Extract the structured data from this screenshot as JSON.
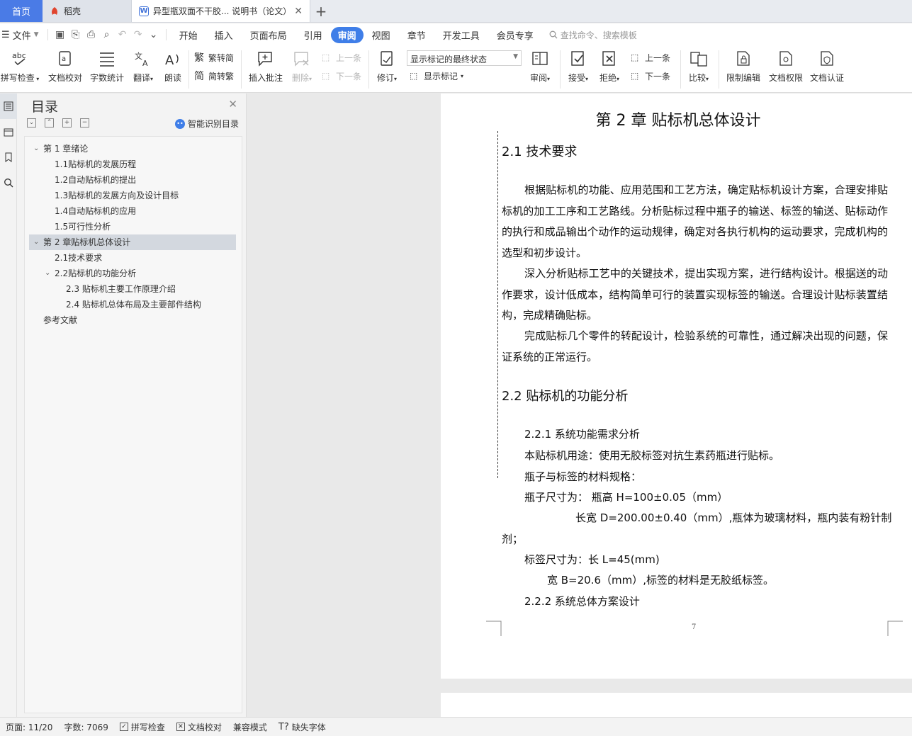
{
  "tabs": {
    "home": "首页",
    "daoke": "稻壳",
    "document": "异型瓶双面不干胶... 说明书（论文）"
  },
  "menubar": {
    "file": "文件",
    "items": [
      "开始",
      "插入",
      "页面布局",
      "引用",
      "审阅",
      "视图",
      "章节",
      "开发工具",
      "会员专享"
    ],
    "active_item": "审阅",
    "search_placeholder": "查找命令、搜索模板"
  },
  "ribbon": {
    "spellcheck": "拼写检查",
    "doc_proof": "文档校对",
    "word_count": "字数统计",
    "translate": "翻译",
    "read_aloud": "朗读",
    "to_traditional": "繁转简",
    "to_simplified": "简转繁",
    "insert_comment": "插入批注",
    "delete": "删除",
    "prev": "上一条",
    "next": "下一条",
    "track_changes": "修订",
    "markup_state": "显示标记的最终状态",
    "show_markup": "显示标记",
    "review": "审阅",
    "accept": "接受",
    "reject": "拒绝",
    "prev2": "上一条",
    "next2": "下一条",
    "compare": "比较",
    "restrict_edit": "限制编辑",
    "doc_permission": "文档权限",
    "doc_cert": "文档认证"
  },
  "toc": {
    "title": "目录",
    "smart": "智能识别目录",
    "items": [
      {
        "label": "第 1 章绪论"
      },
      {
        "label": "1.1贴标机的发展历程"
      },
      {
        "label": "1.2自动贴标机的提出"
      },
      {
        "label": "1.3贴标机的发展方向及设计目标"
      },
      {
        "label": "1.4自动贴标机的应用"
      },
      {
        "label": "1.5可行性分析"
      },
      {
        "label": "第 2 章贴标机总体设计"
      },
      {
        "label": "2.1技术要求"
      },
      {
        "label": "2.2贴标机的功能分析"
      },
      {
        "label": "2.3 贴标机主要工作原理介绍"
      },
      {
        "label": "2.4  贴标机总体布局及主要部件结构"
      },
      {
        "label": "参考文献"
      }
    ]
  },
  "document": {
    "chapter": "第 2 章  贴标机总体设计",
    "h21": "2.1  技术要求",
    "p1": "根据贴标机的功能、应用范围和工艺方法，确定贴标机设计方案，合理安排贴标机的加工工序和工艺路线。分析贴标过程中瓶子的输送、标签的输送、贴标动作的执行和成品输出个动作的运动规律，确定对各执行机构的运动要求，完成机构的选型和初步设计。",
    "p2": "深入分析贴标工艺中的关键技术，提出实现方案，进行结构设计。根据送的动作要求，设计低成本，结构简单可行的装置实现标签的输送。合理设计贴标装置结构，完成精确贴标。",
    "p3": "完成贴标几个零件的转配设计，检验系统的可靠性，通过解决出现的问题，保证系统的正常运行。",
    "h22": "2.2  贴标机的功能分析",
    "l1": "2.2.1 系统功能需求分析",
    "l2": "本贴标机用途：使用无胶标签对抗生素药瓶进行贴标。",
    "l3": "瓶子与标签的材料规格：",
    "l4": "瓶子尺寸为：  瓶高 H=100±0.05（mm）",
    "l5": "长宽 D=200.00±0.40（mm）,瓶体为玻璃材料，瓶内装有粉针制",
    "l5b": "剂；",
    "l6": "标签尺寸为：长 L=45(mm)",
    "l7": "宽 B=20.6（mm）,标签的材料是无胶纸标签。",
    "l8": "2.2.2 系统总体方案设计",
    "page_number": "7"
  },
  "status": {
    "page": "页面: 11/20",
    "words": "字数: 7069",
    "spellcheck": "拼写检查",
    "proof": "文档校对",
    "compat": "兼容模式",
    "missing_font": "缺失字体"
  },
  "colors": {
    "accent": "#3f7ee8",
    "home_tab": "#4a7be6",
    "toc_active": "#d3d8df"
  }
}
